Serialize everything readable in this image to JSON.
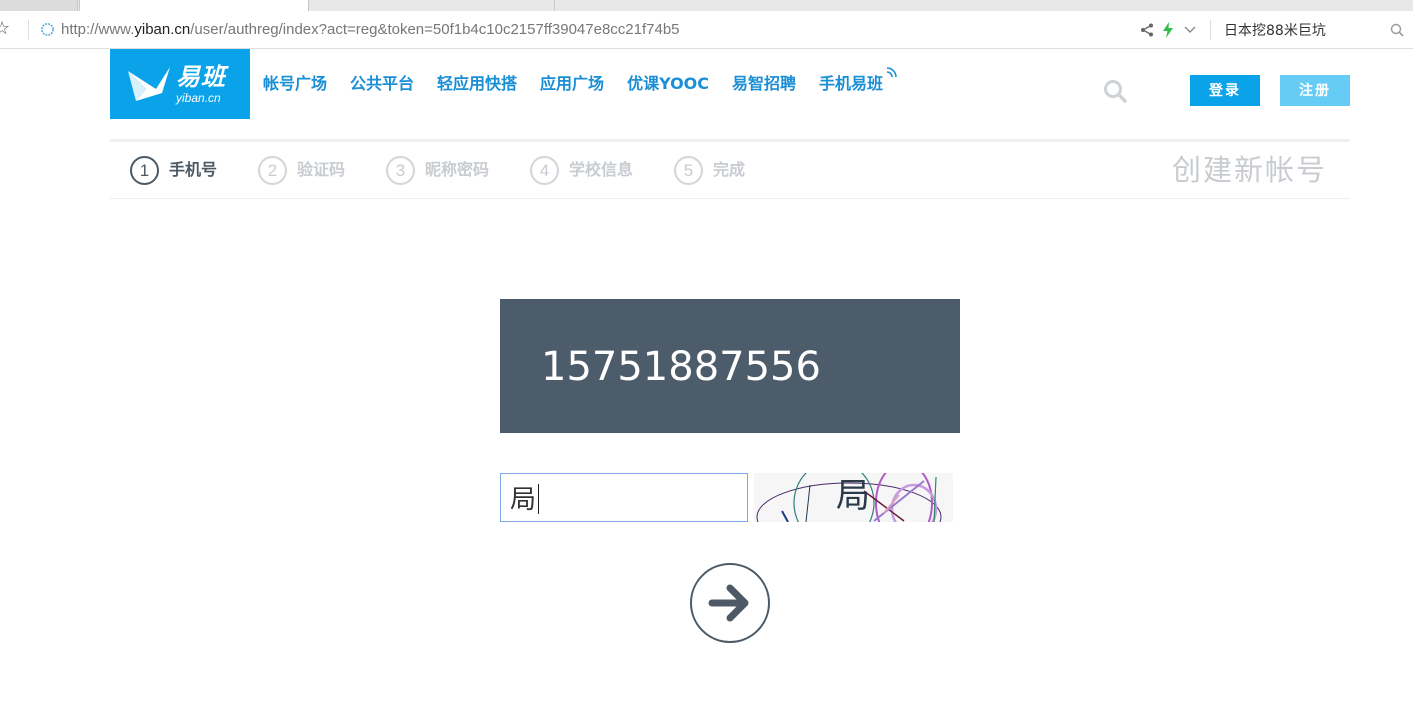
{
  "browser": {
    "url_prefix": "http://www.",
    "url_host": "yiban.cn",
    "url_path": "/user/authreg/index?act=reg&token=50f1b4c10c2157ff39047e8cc21f74b5",
    "search_text": "日本挖88米巨坑"
  },
  "header": {
    "logo_cn": "易班",
    "logo_en": "yiban.cn",
    "nav": [
      "帐号广场",
      "公共平台",
      "轻应用快搭",
      "应用广场",
      "优课YOOC",
      "易智招聘",
      "手机易班"
    ],
    "login_label": "登录",
    "register_label": "注册"
  },
  "steps": [
    {
      "num": "1",
      "label": "手机号"
    },
    {
      "num": "2",
      "label": "验证码"
    },
    {
      "num": "3",
      "label": "昵称密码"
    },
    {
      "num": "4",
      "label": "学校信息"
    },
    {
      "num": "5",
      "label": "完成"
    }
  ],
  "create_title": "创建新帐号",
  "form": {
    "phone": "15751887556",
    "captcha_value": "局",
    "captcha_image_glyph": "局"
  },
  "colors": {
    "brand_blue": "#0aa2e8",
    "nav_blue": "#1a8fd6",
    "panel_slate": "#4d5c6b"
  }
}
